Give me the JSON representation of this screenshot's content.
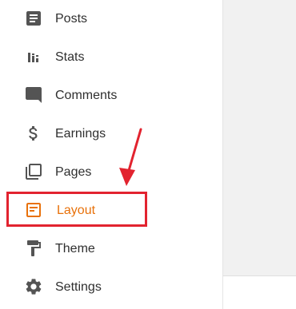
{
  "sidebar": {
    "items": [
      {
        "label": "Posts",
        "icon": "posts-icon"
      },
      {
        "label": "Stats",
        "icon": "stats-icon"
      },
      {
        "label": "Comments",
        "icon": "comments-icon"
      },
      {
        "label": "Earnings",
        "icon": "dollar-icon"
      },
      {
        "label": "Pages",
        "icon": "pages-icon"
      },
      {
        "label": "Layout",
        "icon": "layout-icon",
        "active": true
      },
      {
        "label": "Theme",
        "icon": "paint-roller-icon"
      },
      {
        "label": "Settings",
        "icon": "gear-icon"
      }
    ]
  },
  "colors": {
    "icon": "#545454",
    "text": "#2f2f2f",
    "active": "#e8710a",
    "annotation": "#e2232f",
    "main_background": "#f1f1f1"
  }
}
